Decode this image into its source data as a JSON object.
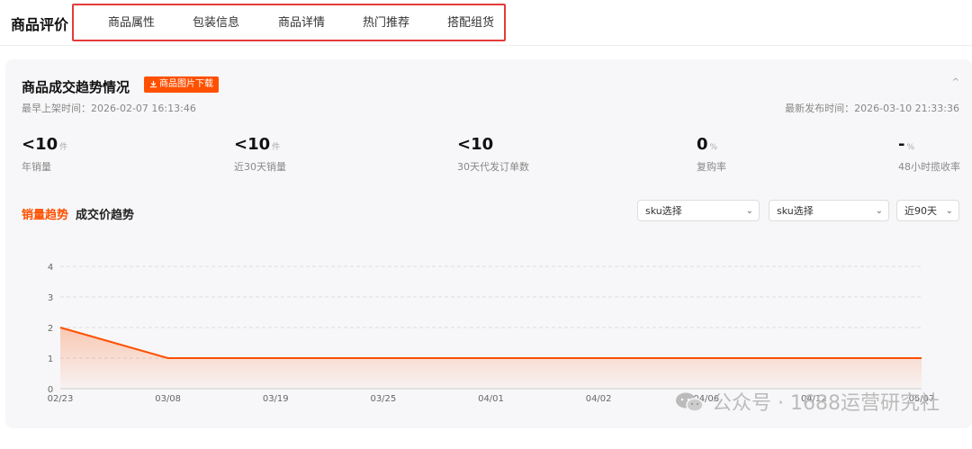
{
  "header": {
    "title": "商品评价",
    "tabs": [
      "商品属性",
      "包装信息",
      "商品详情",
      "热门推荐",
      "搭配组货"
    ]
  },
  "panel": {
    "title": "商品成交趋势情况",
    "download_label": "商品图片下载",
    "earliest_listing": "最早上架时间：2026-02-07 16:13:46",
    "latest_publish": "最新发布时间：2026-03-10 21:33:36",
    "stats": [
      {
        "value": "<10",
        "unit": "件",
        "label": "年销量"
      },
      {
        "value": "<10",
        "unit": "件",
        "label": "近30天销量"
      },
      {
        "value": "<10",
        "unit": "",
        "label": "30天代发订单数"
      },
      {
        "value": "0",
        "unit": "%",
        "label": "复购率"
      },
      {
        "value": "-",
        "unit": "%",
        "label": "48小时揽收率"
      }
    ],
    "trend_tabs": {
      "active": "销量趋势",
      "inactive": "成交价趋势"
    },
    "selects": {
      "sku1": "sku选择",
      "sku2": "sku选择",
      "range": "近90天"
    }
  },
  "chart_data": {
    "type": "area",
    "x": [
      "02/23",
      "03/08",
      "03/19",
      "03/25",
      "04/01",
      "04/02",
      "04/06",
      "04/12",
      "05/07"
    ],
    "series": [
      {
        "values": [
          2,
          1,
          1,
          1,
          1,
          1,
          1,
          1,
          1
        ]
      }
    ],
    "y_ticks": [
      0,
      1,
      2,
      3,
      4
    ],
    "ylim": [
      0,
      4
    ],
    "grid": true,
    "color": "#ff5000"
  },
  "watermark": "公众号 · 1688运营研究社"
}
